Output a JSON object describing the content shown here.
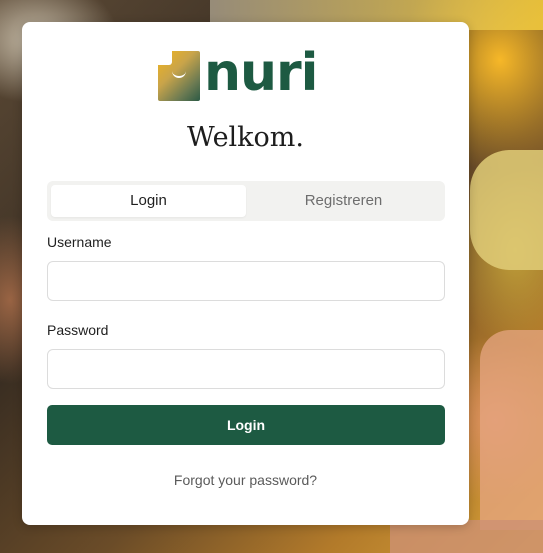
{
  "brand": {
    "name": "nuri",
    "logo_icon": "nuri-logo-mark",
    "primary_color": "#1d5a42",
    "accent_color": "#f2b51c"
  },
  "heading": "Welkom.",
  "tabs": [
    {
      "label": "Login",
      "active": true
    },
    {
      "label": "Registreren",
      "active": false
    }
  ],
  "form": {
    "username_label": "Username",
    "username_value": "",
    "password_label": "Password",
    "password_value": "",
    "submit_label": "Login"
  },
  "forgot_password_label": "Forgot your password?"
}
